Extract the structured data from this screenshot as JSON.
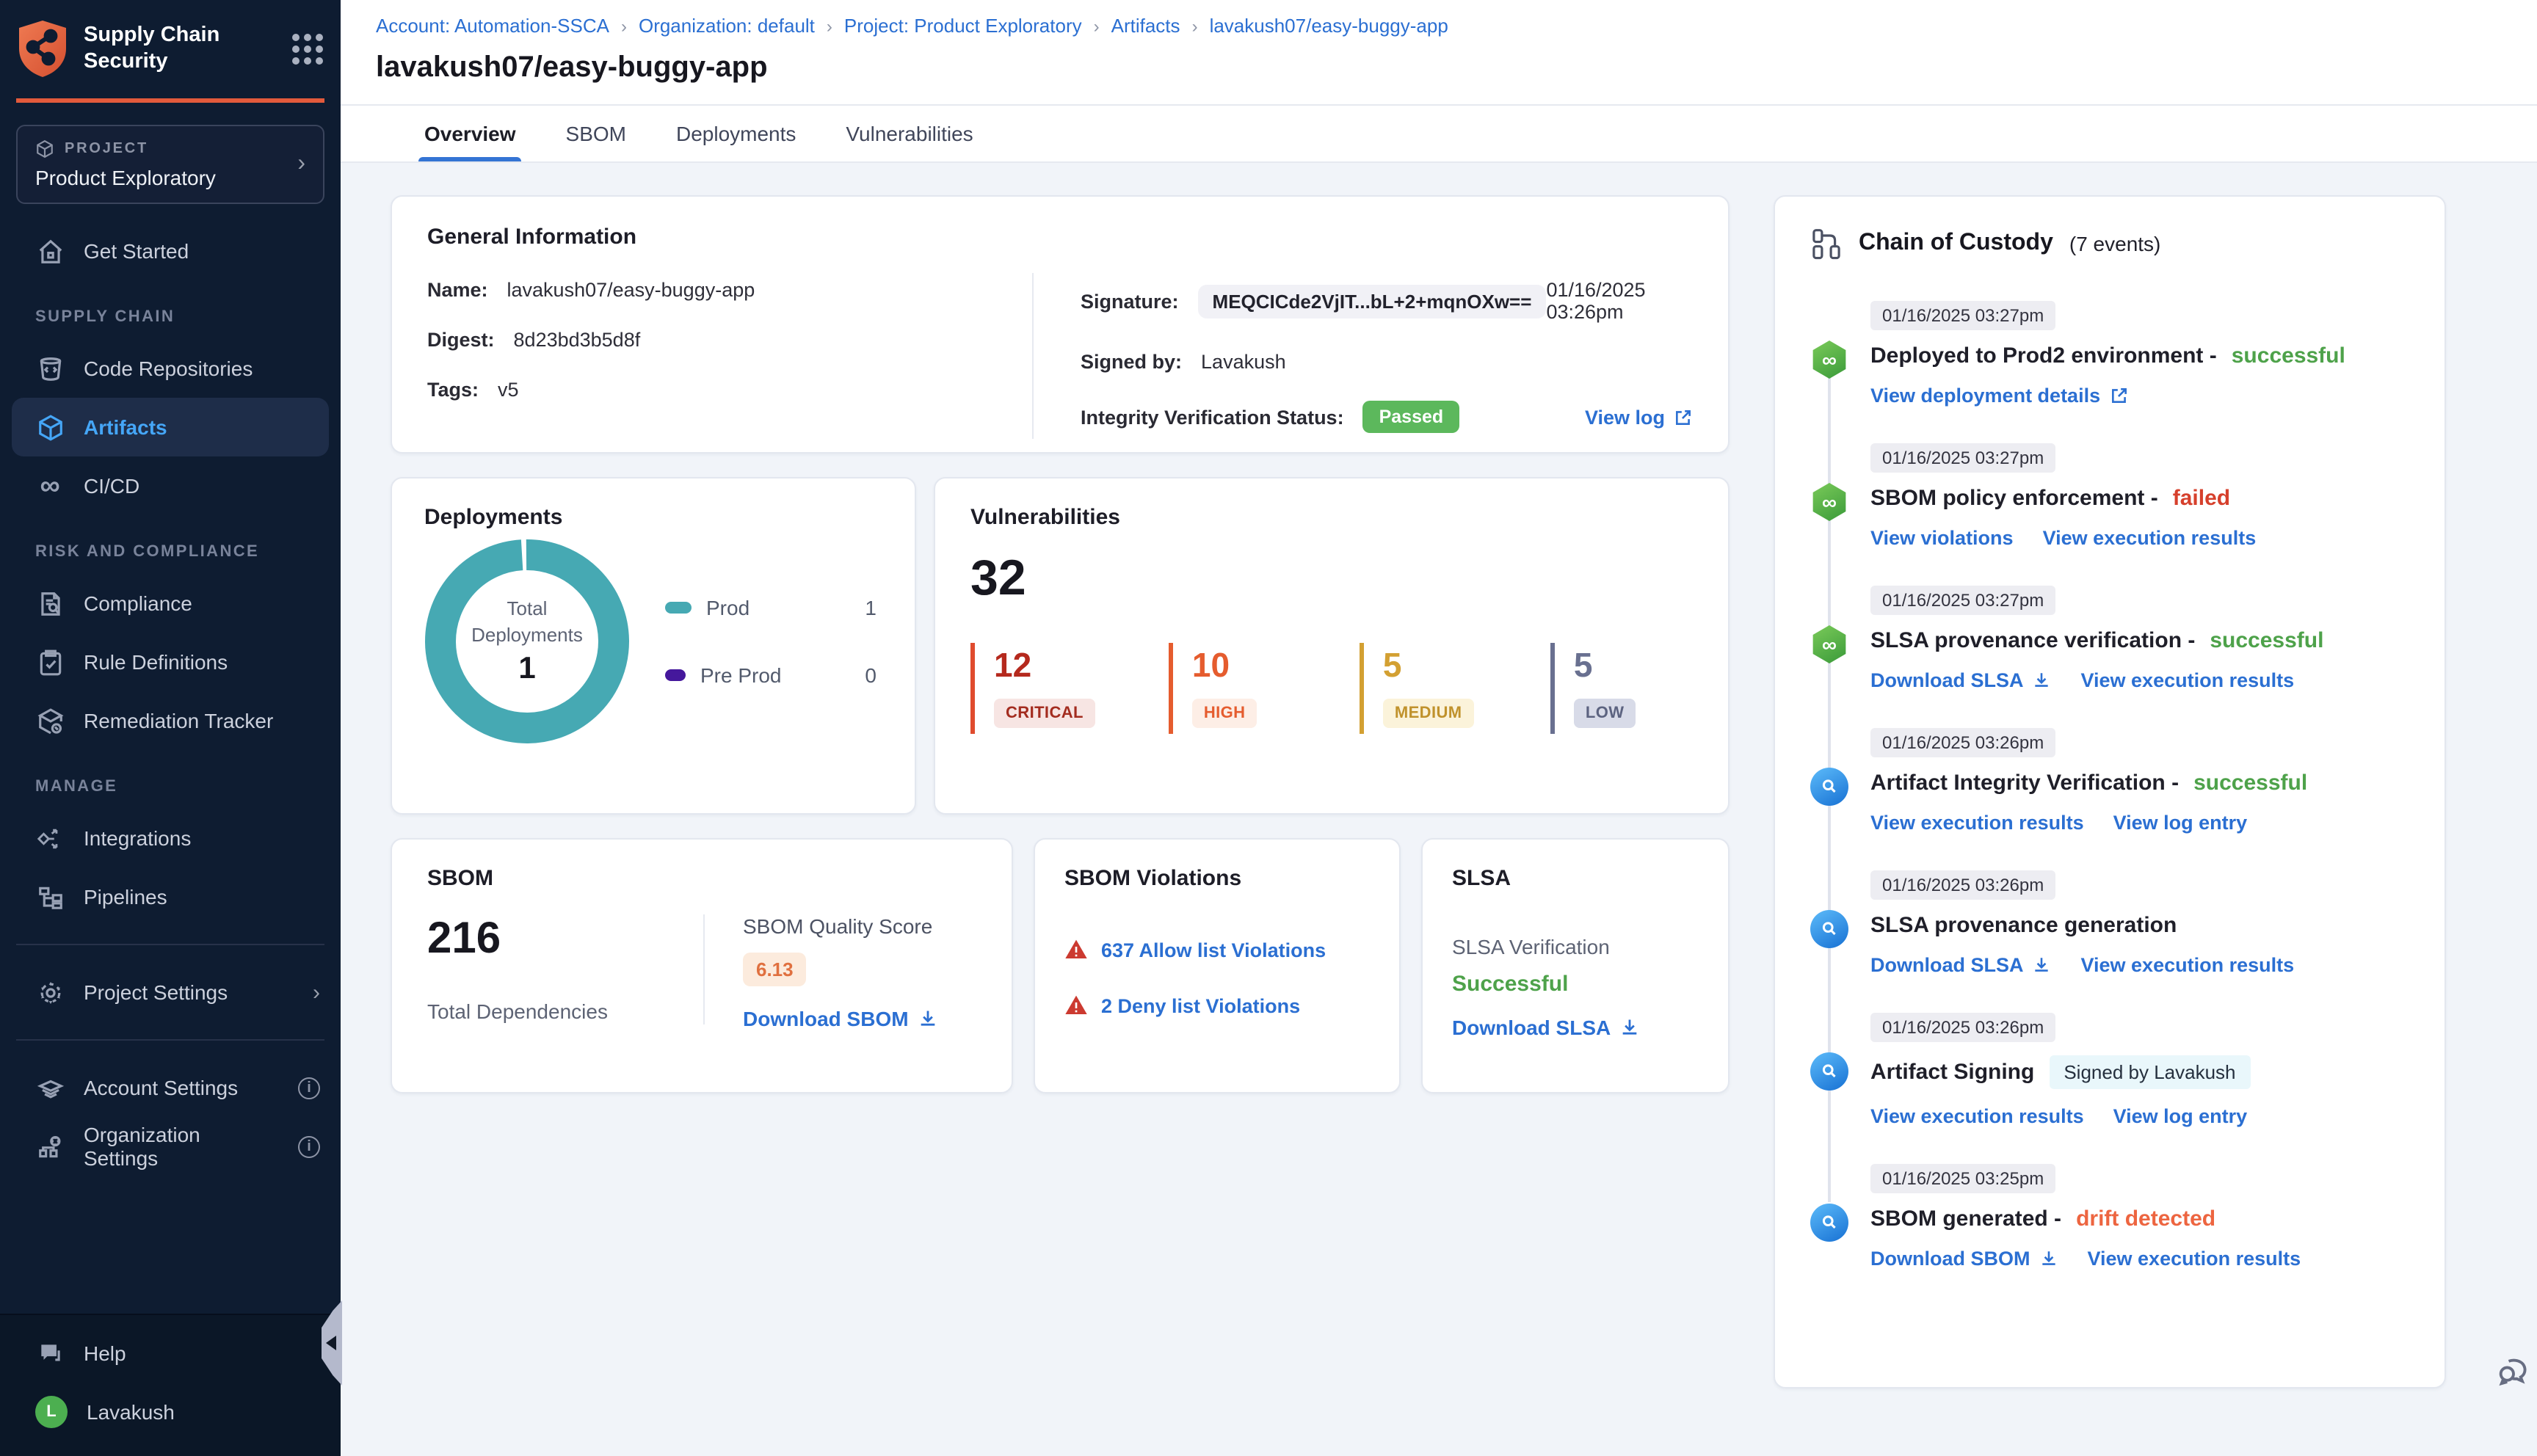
{
  "sidebar": {
    "brand": {
      "line1": "Supply Chain",
      "line2": "Security"
    },
    "project": {
      "eyebrow": "PROJECT",
      "name": "Product Exploratory"
    },
    "items": {
      "get_started": "Get Started",
      "supply_chain_label": "SUPPLY CHAIN",
      "code_repositories": "Code Repositories",
      "artifacts": "Artifacts",
      "cicd": "CI/CD",
      "risk_label": "RISK AND COMPLIANCE",
      "compliance": "Compliance",
      "rule_definitions": "Rule Definitions",
      "remediation_tracker": "Remediation Tracker",
      "manage_label": "MANAGE",
      "integrations": "Integrations",
      "pipelines": "Pipelines",
      "project_settings": "Project Settings",
      "account_settings": "Account Settings",
      "organization_settings": "Organization Settings",
      "help": "Help",
      "user": "Lavakush",
      "user_initial": "L"
    }
  },
  "header": {
    "sep": "›",
    "breadcrumb": [
      "Account: Automation-SSCA",
      "Organization: default",
      "Project: Product Exploratory",
      "Artifacts",
      "lavakush07/easy-buggy-app"
    ],
    "title": "lavakush07/easy-buggy-app",
    "tabs": [
      "Overview",
      "SBOM",
      "Deployments",
      "Vulnerabilities"
    ],
    "active_tab": "Overview"
  },
  "general_info": {
    "title": "General Information",
    "name_label": "Name:",
    "name": "lavakush07/easy-buggy-app",
    "digest_label": "Digest:",
    "digest": "8d23bd3b5d8f",
    "tags_label": "Tags:",
    "tags": "v5",
    "signature_label": "Signature:",
    "signature": "MEQCICde2VjIT...bL+2+mqnOXw==",
    "signature_date": "01/16/2025 03:26pm",
    "signed_by_label": "Signed by:",
    "signed_by": "Lavakush",
    "integrity_label": "Integrity Verification Status:",
    "integrity_status": "Passed",
    "view_log": "View log"
  },
  "deployments": {
    "title": "Deployments",
    "center_label_1": "Total",
    "center_label_2": "Deployments",
    "total": "1",
    "chart_data": {
      "type": "pie",
      "categories": [
        "Prod",
        "Pre Prod"
      ],
      "values": [
        1,
        0
      ],
      "colors": [
        "#46a9b3",
        "#45189c"
      ]
    },
    "legend": [
      {
        "label": "Prod",
        "value": "1"
      },
      {
        "label": "Pre Prod",
        "value": "0"
      }
    ]
  },
  "vulnerabilities": {
    "title": "Vulnerabilities",
    "total": "32",
    "severities": [
      {
        "count": "12",
        "label": "CRITICAL"
      },
      {
        "count": "10",
        "label": "HIGH"
      },
      {
        "count": "5",
        "label": "MEDIUM"
      },
      {
        "count": "5",
        "label": "LOW"
      }
    ]
  },
  "sbom": {
    "title": "SBOM",
    "total": "216",
    "total_label": "Total Dependencies",
    "quality_label": "SBOM Quality Score",
    "quality_score": "6.13",
    "download": "Download SBOM"
  },
  "sbom_violations": {
    "title": "SBOM Violations",
    "allow": "637 Allow list Violations",
    "deny": "2 Deny list Violations"
  },
  "slsa": {
    "title": "SLSA",
    "verification_label": "SLSA Verification",
    "verification_status": "Successful",
    "download": "Download SLSA"
  },
  "chain": {
    "title": "Chain of Custody",
    "count": "(7 events)",
    "events": [
      {
        "time": "01/16/2025 03:27pm",
        "title": "Deployed to Prod2 environment -",
        "status": "successful",
        "link1": "View deployment details",
        "link2": ""
      },
      {
        "time": "01/16/2025 03:27pm",
        "title": "SBOM policy enforcement -",
        "status": "failed",
        "link1": "View violations",
        "link2": "View execution results"
      },
      {
        "time": "01/16/2025 03:27pm",
        "title": "SLSA provenance verification -",
        "status": "successful",
        "link1": "Download SLSA",
        "link2": "View execution results"
      },
      {
        "time": "01/16/2025 03:26pm",
        "title": "Artifact Integrity Verification -",
        "status": "successful",
        "link1": "View execution results",
        "link2": "View log entry"
      },
      {
        "time": "01/16/2025 03:26pm",
        "title": "SLSA provenance generation",
        "status": "",
        "link1": "Download SLSA",
        "link2": "View execution results"
      },
      {
        "time": "01/16/2025 03:26pm",
        "title": "Artifact Signing",
        "status": "",
        "badge": "Signed by Lavakush",
        "link1": "View execution results",
        "link2": "View log entry"
      },
      {
        "time": "01/16/2025 03:25pm",
        "title": "SBOM generated -",
        "status": "drift detected",
        "link1": "Download SBOM",
        "link2": "View execution results"
      }
    ]
  }
}
